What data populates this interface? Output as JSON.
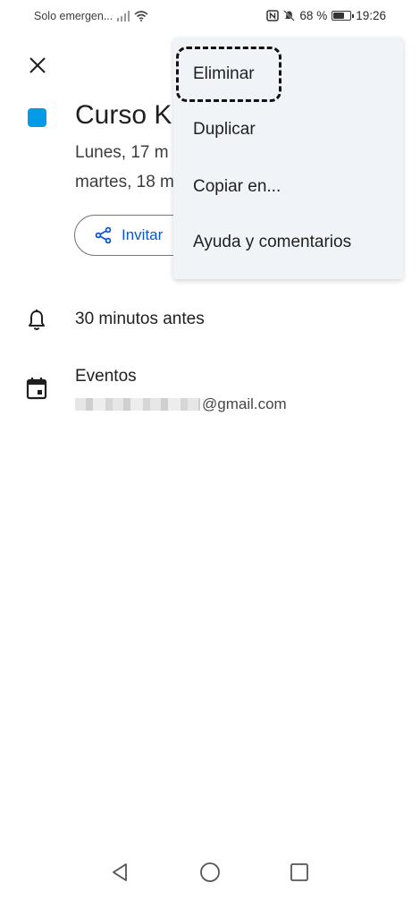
{
  "status_bar": {
    "carrier": "Solo emergen...",
    "battery_percent": "68 %",
    "battery_level": 0.68,
    "time": "19:26"
  },
  "event": {
    "title": "Curso K",
    "date_line1": "Lunes, 17 m",
    "date_line2": "martes, 18 m",
    "color": "#039be5",
    "invite_label": "Invitar"
  },
  "notification": {
    "text": "30 minutos antes"
  },
  "calendar": {
    "name": "Eventos",
    "email_suffix": "@gmail.com"
  },
  "menu": {
    "items": [
      "Eliminar",
      "Duplicar",
      "Copiar en...",
      "Ayuda y comentarios"
    ]
  },
  "icons": {
    "close": "close-icon",
    "share": "share-icon",
    "bell": "bell-icon",
    "calendar": "calendar-icon",
    "back": "back-triangle-icon",
    "home": "home-circle-icon",
    "recents": "recents-square-icon"
  }
}
